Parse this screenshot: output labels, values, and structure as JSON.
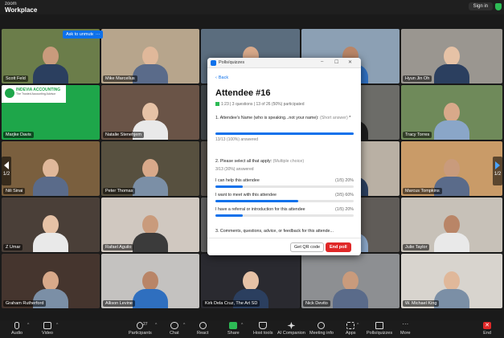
{
  "brand": {
    "line1": "zoom",
    "line2": "Workplace"
  },
  "topbar": {
    "signin_label": "Sign in"
  },
  "speaker_actions": {
    "ask_unmute": "Ask to unmute",
    "more": "···"
  },
  "participants": [
    "Scott Feld",
    "Mike Marcellus",
    "",
    "",
    "Hyun Jin Oh",
    "Marjke Davis",
    "Natalie Stenehjem",
    "",
    "",
    "Tracy Torres",
    "Nili Sinai",
    "Peter Thomas",
    "",
    "",
    "Marcus Tompkins",
    "Z Umar",
    "Rafael Aguilo",
    "",
    "",
    "Julie Taylor",
    "Graham Rutherford",
    "Allison Levine",
    "Kirk Dela Cruz, The Art SD",
    "Nick Devito",
    "W. Michael King"
  ],
  "logo_tile": {
    "name": "INDEVIA ACCOUNTING",
    "tagline": "The Trusted Accounting Advisor"
  },
  "page_nav": {
    "left": "1/2",
    "right": "1/2"
  },
  "poll": {
    "window_title": "Polls/quizzes",
    "back_label": "Back",
    "title": "Attendee #16",
    "stats": "1:23 | 3 questions | 13 of 26 (50%) participated",
    "q1": {
      "text": "1. Attendee's Name (who is speaking...not your name):",
      "type": "(Short answer)",
      "star": "*",
      "answered": "13/13 (100%) answered",
      "fill": 1.0
    },
    "q2": {
      "text": "2. Please select all that apply:",
      "type": "(Multiple choice)",
      "answered": "3/13 (30%) answered",
      "options": [
        {
          "label": "I can help this attendee",
          "pct": "(1/5) 20%",
          "fill": 0.2
        },
        {
          "label": "I want to meet with this attendee",
          "pct": "(3/5) 60%",
          "fill": 0.6
        },
        {
          "label": "I have a referral or introduction for this attendee",
          "pct": "(1/5) 20%",
          "fill": 0.2
        }
      ]
    },
    "q3": {
      "text": "3. Comments, questions, advice, or feedback for this attende..."
    },
    "qr_label": "Get QR code",
    "end_label": "End poll"
  },
  "toolbar": {
    "audio": "Audio",
    "video": "Video",
    "participants": "Participants",
    "participant_count": "27",
    "chat": "Chat",
    "react": "React",
    "share": "Share",
    "host_tools": "Host tools",
    "ai": "AI Companion",
    "meeting_info": "Meeting info",
    "apps": "Apps",
    "polls": "Polls/quizzes",
    "more": "More",
    "end": "End"
  },
  "colors": {
    "accent": "#0e71eb",
    "end": "#e02828",
    "share": "#2dbb55"
  }
}
